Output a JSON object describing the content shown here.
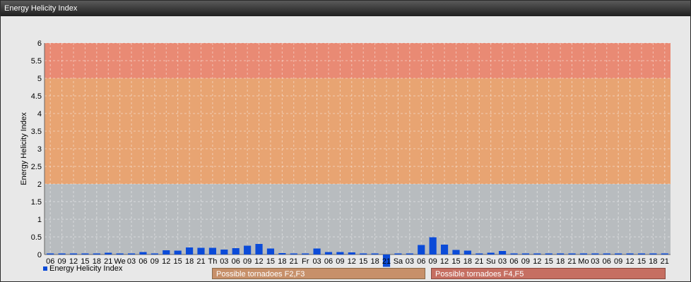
{
  "window": {
    "title": "Energy Helicity Index"
  },
  "colors": {
    "bar": "#0b4bd8",
    "band_low": "#b8bcbf",
    "band_mid": "#e8a472",
    "band_high": "#e98a74",
    "plot_bg": "#c9cccf"
  },
  "legend": {
    "label": "Energy Helicity Index"
  },
  "bands": [
    {
      "label": "Possible tornadoes F2,F3",
      "from": 2,
      "to": 5
    },
    {
      "label": "Possible tornadoes F4,F5",
      "from": 5,
      "to": 6
    }
  ],
  "chart_data": {
    "type": "bar",
    "title": "Energy Helicity Index",
    "xlabel": "",
    "ylabel": "Energy Helicity Index",
    "ylim": [
      0,
      6
    ],
    "yticks": [
      "0",
      "0.5",
      "1",
      "1.5",
      "2",
      "2.5",
      "3",
      "3.5",
      "4",
      "4.5",
      "5",
      "5.5",
      "6"
    ],
    "grid": true,
    "legend_position": "bottom-left",
    "categories": [
      "06",
      "09",
      "12",
      "15",
      "18",
      "21",
      "We",
      "03",
      "06",
      "09",
      "12",
      "15",
      "18",
      "21",
      "Th",
      "03",
      "06",
      "09",
      "12",
      "15",
      "18",
      "21",
      "Fr",
      "03",
      "06",
      "09",
      "12",
      "15",
      "18",
      "21",
      "Sa",
      "03",
      "06",
      "09",
      "12",
      "15",
      "18",
      "21",
      "Su",
      "03",
      "06",
      "09",
      "12",
      "15",
      "18",
      "21",
      "Mo",
      "03",
      "06",
      "09",
      "12",
      "15",
      "18",
      "21"
    ],
    "series": [
      {
        "name": "Energy Helicity Index",
        "values": [
          0.01,
          0.01,
          0.01,
          0.01,
          0.02,
          0.05,
          0.01,
          0.01,
          0.07,
          0.02,
          0.12,
          0.11,
          0.2,
          0.19,
          0.19,
          0.14,
          0.18,
          0.25,
          0.3,
          0.17,
          0.04,
          0.01,
          0.01,
          0.17,
          0.07,
          0.07,
          0.06,
          0.03,
          0.01,
          -0.35,
          0.01,
          0.01,
          0.27,
          0.49,
          0.28,
          0.13,
          0.11,
          0.01,
          0.05,
          0.1,
          0.01,
          0.01,
          0.01,
          0.01,
          0.01,
          0.01,
          0.01,
          0.01,
          0.01,
          0.01,
          0.01,
          0.01,
          0.01,
          0.01
        ]
      }
    ]
  }
}
